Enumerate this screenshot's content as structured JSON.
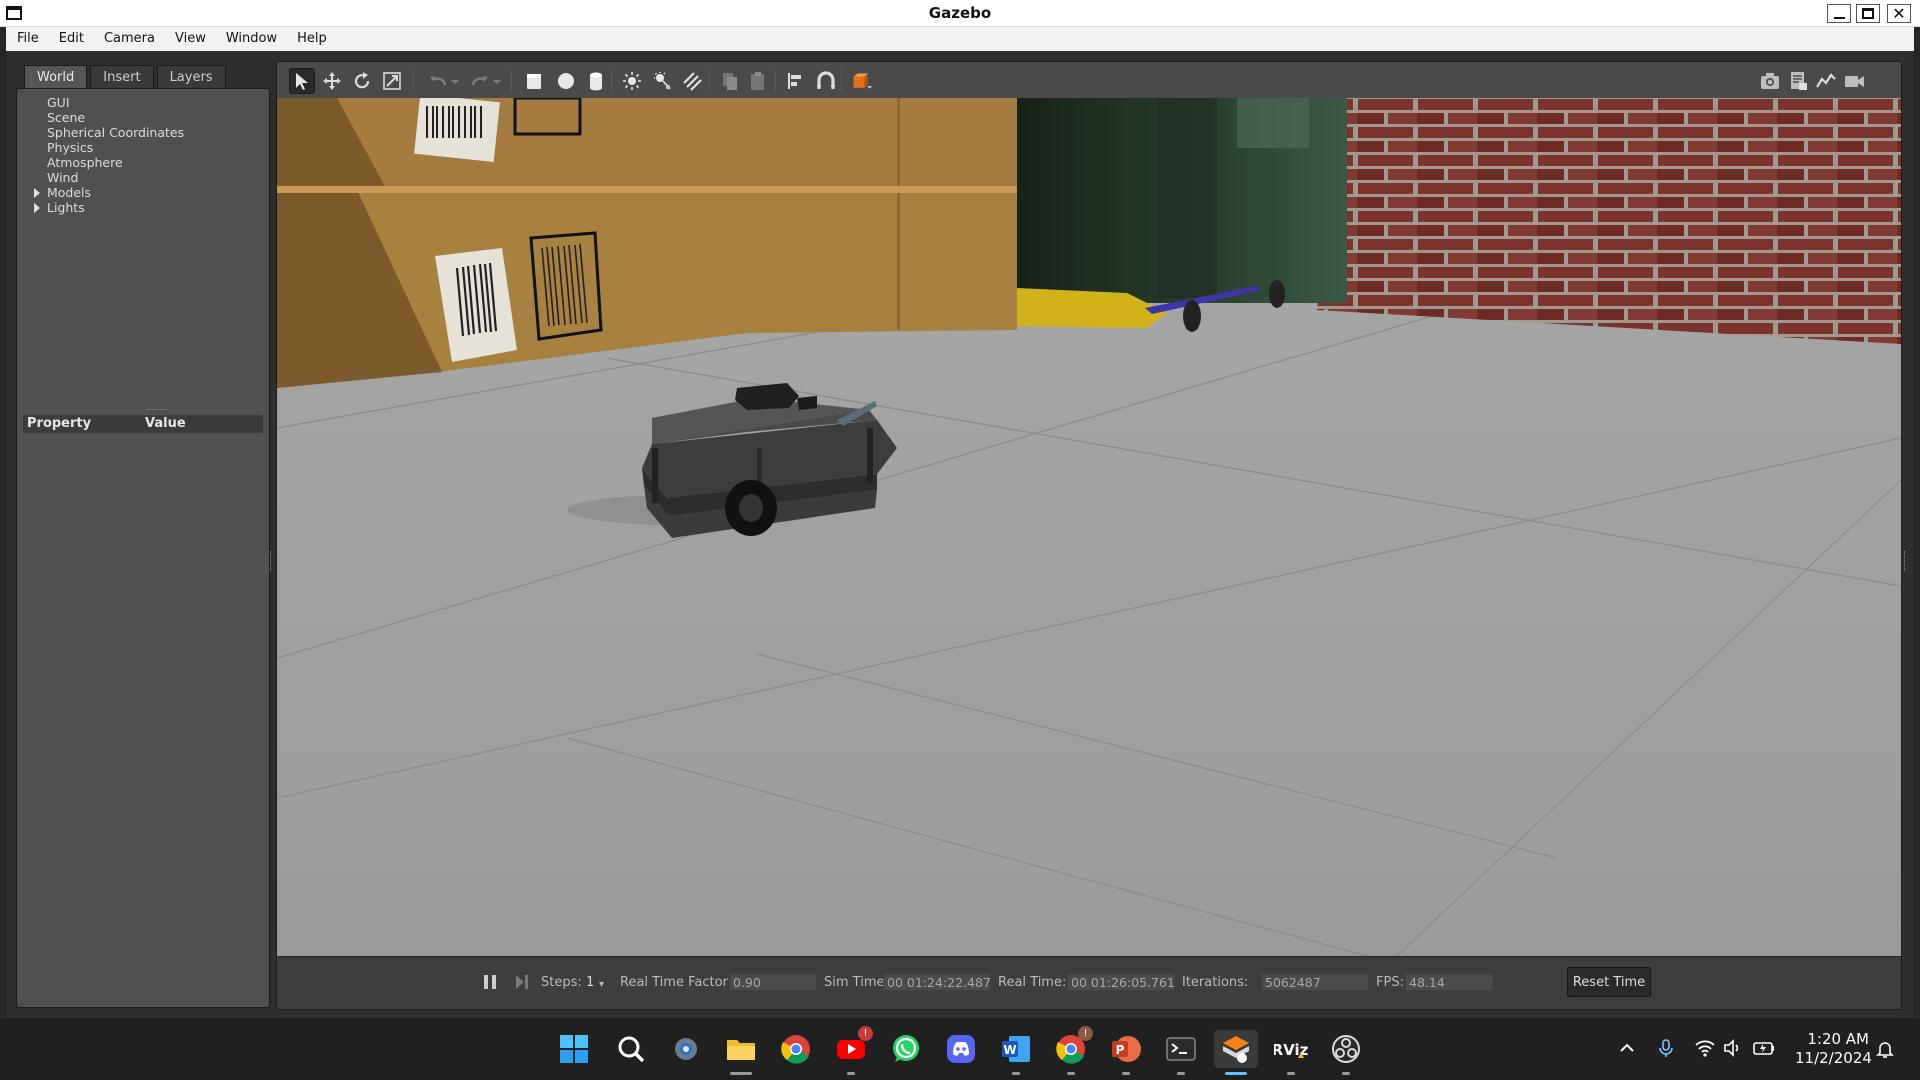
{
  "window": {
    "title": "Gazebo",
    "controls": {
      "minimize": "minimize-icon",
      "maximize": "maximize-icon",
      "close": "close-icon"
    }
  },
  "menu": [
    "File",
    "Edit",
    "Camera",
    "View",
    "Window",
    "Help"
  ],
  "left_panel": {
    "tabs": [
      "World",
      "Insert",
      "Layers"
    ],
    "active_tab": "World",
    "tree": [
      {
        "label": "GUI",
        "expandable": false
      },
      {
        "label": "Scene",
        "expandable": false
      },
      {
        "label": "Spherical Coordinates",
        "expandable": false
      },
      {
        "label": "Physics",
        "expandable": false
      },
      {
        "label": "Atmosphere",
        "expandable": false
      },
      {
        "label": "Wind",
        "expandable": false
      },
      {
        "label": "Models",
        "expandable": true
      },
      {
        "label": "Lights",
        "expandable": true
      }
    ],
    "property_header": {
      "property": "Property",
      "value": "Value"
    }
  },
  "toolbar": {
    "left": [
      "select-mode-icon",
      "translate-mode-icon",
      "rotate-mode-icon",
      "scale-mode-icon",
      "undo-icon",
      "undo-dropdown-icon",
      "redo-icon",
      "redo-dropdown-icon",
      "box-shape-icon",
      "sphere-shape-icon",
      "cylinder-shape-icon",
      "point-light-icon",
      "spot-light-icon",
      "directional-light-icon",
      "copy-icon",
      "paste-icon",
      "align-icon",
      "snap-icon",
      "change-view-icon"
    ],
    "right": [
      "screenshot-icon",
      "log-icon",
      "plot-icon",
      "video-record-icon"
    ]
  },
  "status": {
    "pause_icon": "pause-icon",
    "step_icon": "step-icon",
    "steps_label": "Steps:",
    "steps_value": "1",
    "rtf_label": "Real Time Factor:",
    "rtf_value": "0.90",
    "sim_time_label": "Sim Time:",
    "sim_time_value": "00 01:24:22.487",
    "real_time_label": "Real Time:",
    "real_time_value": "00 01:26:05.761",
    "iterations_label": "Iterations:",
    "iterations_value": "5062487",
    "fps_label": "FPS:",
    "fps_value": "48.14",
    "reset_label": "Reset Time"
  },
  "taskbar": {
    "apps": [
      {
        "name": "windows-start-icon"
      },
      {
        "name": "search-icon"
      },
      {
        "name": "settings-icon"
      },
      {
        "name": "file-explorer-icon"
      },
      {
        "name": "chrome-icon"
      },
      {
        "name": "youtube-icon",
        "badge": "!"
      },
      {
        "name": "whatsapp-icon"
      },
      {
        "name": "discord-icon"
      },
      {
        "name": "word-icon"
      },
      {
        "name": "chrome-profile-icon",
        "badge": "!"
      },
      {
        "name": "powerpoint-icon"
      },
      {
        "name": "terminal-icon"
      },
      {
        "name": "gazebo-icon"
      },
      {
        "name": "rviz-icon",
        "label": "RViz"
      },
      {
        "name": "obs-icon"
      }
    ],
    "tray": [
      "chevron-up-icon",
      "microphone-icon",
      "wifi-icon",
      "volume-icon",
      "battery-icon"
    ],
    "time": "1:20 AM",
    "date": "11/2/2024",
    "notification_icon": "bell-icon"
  },
  "colors": {
    "gazebo_panel": "#505050",
    "toolbar": "#4a4a4a",
    "floor": "#9a9a9a",
    "brick": "#8e3b32",
    "cardboard": "#a67b40",
    "taskbar": "#202020",
    "accent": "#5cc0ff"
  }
}
